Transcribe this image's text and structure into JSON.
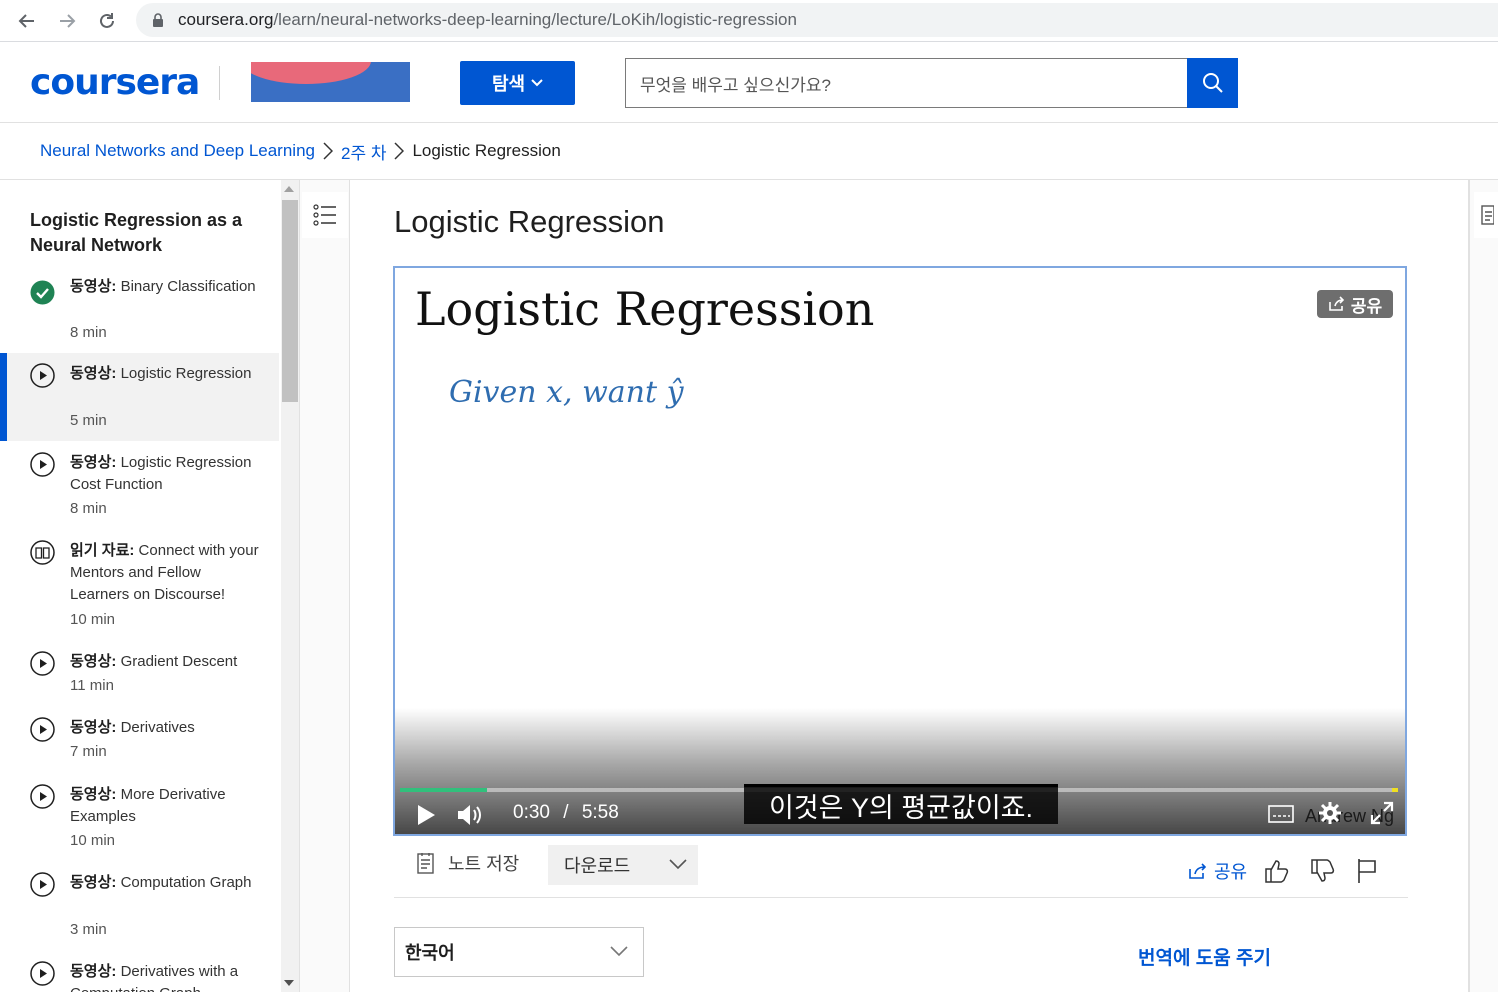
{
  "browser": {
    "url_host": "coursera.org",
    "url_path": "/learn/neural-networks-deep-learning/lecture/LoKih/logistic-regression"
  },
  "header": {
    "logo": "coursera",
    "explore_label": "탐색",
    "search_placeholder": "무엇을 배우고 싶으신가요?"
  },
  "breadcrumb": {
    "course": "Neural Networks and Deep Learning",
    "week": "2주 차",
    "current": "Logistic Regression"
  },
  "sidebar": {
    "title": "Logistic Regression as a Neural Network",
    "items": [
      {
        "type": "동영상:",
        "label": "Binary Classification",
        "duration": "8 min",
        "status": "completed"
      },
      {
        "type": "동영상:",
        "label": "Logistic Regression",
        "duration": "5 min",
        "status": "active"
      },
      {
        "type": "동영상:",
        "label": "Logistic Regression Cost Function",
        "duration": "8 min",
        "status": "video"
      },
      {
        "type": "읽기 자료:",
        "label": "Connect with your Mentors and Fellow Learners on Discourse!",
        "duration": "10 min",
        "status": "reading"
      },
      {
        "type": "동영상:",
        "label": "Gradient Descent",
        "duration": "11 min",
        "status": "video"
      },
      {
        "type": "동영상:",
        "label": "Derivatives",
        "duration": "7 min",
        "status": "video"
      },
      {
        "type": "동영상:",
        "label": "More Derivative Examples",
        "duration": "10 min",
        "status": "video"
      },
      {
        "type": "동영상:",
        "label": "Computation Graph",
        "duration": "3 min",
        "status": "video"
      },
      {
        "type": "동영상:",
        "label": "Derivatives with a Computation Graph",
        "duration": "",
        "status": "video"
      }
    ]
  },
  "lecture": {
    "title": "Logistic Regression"
  },
  "video": {
    "slide_title": "Logistic Regression",
    "handwriting": "Given x, want ŷ",
    "share_label": "공유",
    "current_time": "0:30",
    "separator": "/",
    "total_time": "5:58",
    "progress": 0.087,
    "caption": "이것은 Y의 평균값이죠.",
    "watermark": "Andrew Ng"
  },
  "actions": {
    "save_note": "노트 저장",
    "download": "다운로드",
    "share": "공유"
  },
  "transcript": {
    "language": "한국어",
    "help_translate": "번역에 도움 주기"
  },
  "colors": {
    "brand_blue": "#0056d2",
    "progress_green": "#31c07c",
    "complete_green": "#1f8354"
  }
}
